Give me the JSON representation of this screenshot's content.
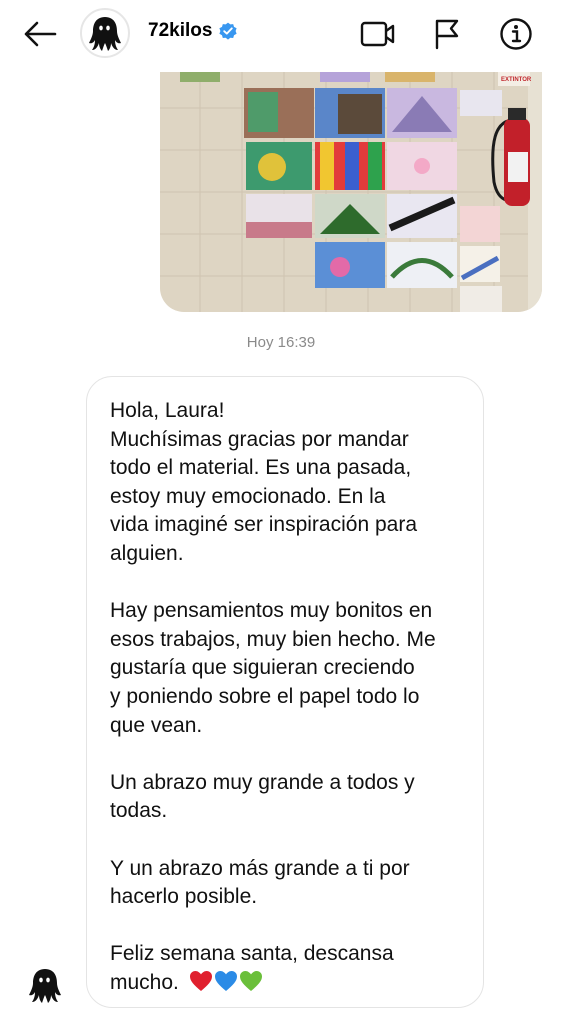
{
  "header": {
    "username": "72kilos",
    "icons": [
      "back-arrow-icon",
      "avatar-ghost",
      "verified-badge-icon",
      "video-call-icon",
      "flag-icon",
      "info-icon"
    ]
  },
  "photo": {
    "description_icons": [
      "wall-of-drawings",
      "fire-extinguisher"
    ],
    "sign_text": "EXTINTOR"
  },
  "timestamp": "Hoy 16:39",
  "message": {
    "lines": [
      "Hola, Laura!",
      "Muchísimas gracias por mandar",
      "todo el material. Es una pasada,",
      "estoy muy emocionado. En la",
      "vida imaginé ser inspiración para",
      "alguien.",
      "",
      "Hay pensamientos muy bonitos en",
      "esos trabajos, muy bien hecho. Me",
      "gustaría que siguieran creciendo",
      "y poniendo sobre el papel todo lo",
      "que vean.",
      "",
      "Un abrazo muy grande a todos y",
      "todas.",
      "",
      "Y un abrazo más grande a ti por",
      "hacerlo posible.",
      "",
      "Feliz semana santa, descansa",
      "mucho."
    ],
    "emojis": [
      "red-heart",
      "blue-heart",
      "green-heart"
    ]
  },
  "colors": {
    "verified": "#3897f0",
    "heart_red": "#e0202e",
    "heart_blue": "#2b8be6",
    "heart_green": "#6abf3a",
    "timestamp": "#8a8a8a",
    "bubble_border": "#e4e4e4"
  }
}
